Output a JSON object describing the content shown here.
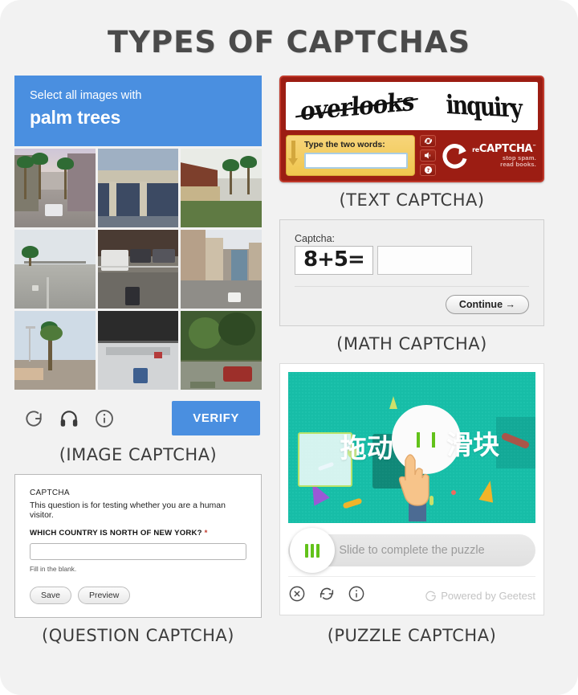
{
  "page": {
    "title": "TYPES OF CAPTCHAS",
    "background": "#f2f2f2",
    "accent_blue": "#4a8fe0"
  },
  "image_captcha": {
    "caption": "(IMAGE CAPTCHA)",
    "prompt_line1": "Select all images with",
    "prompt_line2": "palm trees",
    "header_color": "#4a8fe0",
    "verify_label": "VERIFY",
    "tools": [
      "refresh-icon",
      "audio-icon",
      "info-icon"
    ],
    "tiles": [
      {
        "alt": "street with palm trees"
      },
      {
        "alt": "concrete building facade"
      },
      {
        "alt": "roof with palm trees"
      },
      {
        "alt": "empty road"
      },
      {
        "alt": "parking lot with cars"
      },
      {
        "alt": "city street with buildings"
      },
      {
        "alt": "palm tree and street light"
      },
      {
        "alt": "highway overpass"
      },
      {
        "alt": "red car under trees"
      }
    ]
  },
  "question_captcha": {
    "caption": "(QUESTION CAPTCHA)",
    "title": "CAPTCHA",
    "description": "This question is for testing whether you are a human visitor.",
    "question": "WHICH COUNTRY IS NORTH OF NEW YORK?",
    "required_marker": "*",
    "answer_value": "",
    "hint": "Fill in the blank.",
    "save_label": "Save",
    "preview_label": "Preview"
  },
  "text_captcha": {
    "caption": "(TEXT CAPTCHA)",
    "word1": "overlooks",
    "word2": "inquiry",
    "input_label": "Type the two words:",
    "input_value": "",
    "buttons": [
      "refresh-icon",
      "audio-icon",
      "help-icon"
    ],
    "logo_re": "re",
    "logo_main": "CAPTCHA",
    "logo_tm": "™",
    "logo_sub_line1": "stop spam.",
    "logo_sub_line2": "read books.",
    "frame_color": "#9c1d13"
  },
  "math_captcha": {
    "caption": "(MATH CAPTCHA)",
    "label": "Captcha:",
    "question": "8+5=",
    "answer_value": "",
    "continue_label": "Continue  →"
  },
  "puzzle_captcha": {
    "caption": "(PUZZLE CAPTCHA)",
    "image_text_1": "拖动",
    "image_text_2": "滑块",
    "slider_label": "Slide to complete the puzzle",
    "footer_icons": [
      "close-icon",
      "refresh-icon",
      "info-icon"
    ],
    "powered_by": "Powered by Geetest",
    "background_color": "#17bda7"
  }
}
